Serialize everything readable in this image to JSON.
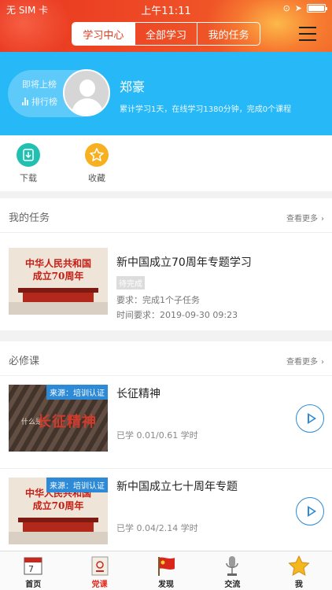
{
  "status": {
    "carrier": "无 SIM 卡",
    "time": "上午11:11"
  },
  "header": {
    "tabs": [
      {
        "label": "学习中心",
        "active": true
      },
      {
        "label": "全部学习",
        "active": false
      },
      {
        "label": "我的任务",
        "active": false
      }
    ]
  },
  "profile": {
    "rank_top": "即将上榜",
    "rank_link": "排行榜",
    "name": "郑豪",
    "stats": "累计学习1天，在线学习1380分钟，完成0个课程"
  },
  "quick": [
    {
      "label": "下载",
      "icon": "download-icon",
      "color": "#22c0b0"
    },
    {
      "label": "收藏",
      "icon": "star-icon",
      "color": "#f6b020"
    }
  ],
  "tasks": {
    "title": "我的任务",
    "more": "查看更多",
    "items": [
      {
        "title": "新中国成立70周年专题学习",
        "status": "待完成",
        "requirement": "要求：完成1个子任务",
        "time": "时间要求：2019-09-30 09:23"
      }
    ]
  },
  "required": {
    "title": "必修课",
    "more": "查看更多",
    "items": [
      {
        "title": "长征精神",
        "source": "来源：培训认证",
        "progress": "已学 0.01/0.61 学时"
      },
      {
        "title": "新中国成立七十周年专题",
        "source": "来源：培训认证",
        "progress": "已学 0.04/2.14 学时"
      }
    ]
  },
  "tabbar": [
    {
      "label": "首页",
      "active": false
    },
    {
      "label": "党课",
      "active": true
    },
    {
      "label": "发现",
      "active": false
    },
    {
      "label": "交流",
      "active": false
    },
    {
      "label": "我",
      "active": false
    }
  ],
  "colors": {
    "accent_red": "#e03a1e",
    "banner_blue": "#27b8f7",
    "link_blue": "#2c8ad6"
  }
}
